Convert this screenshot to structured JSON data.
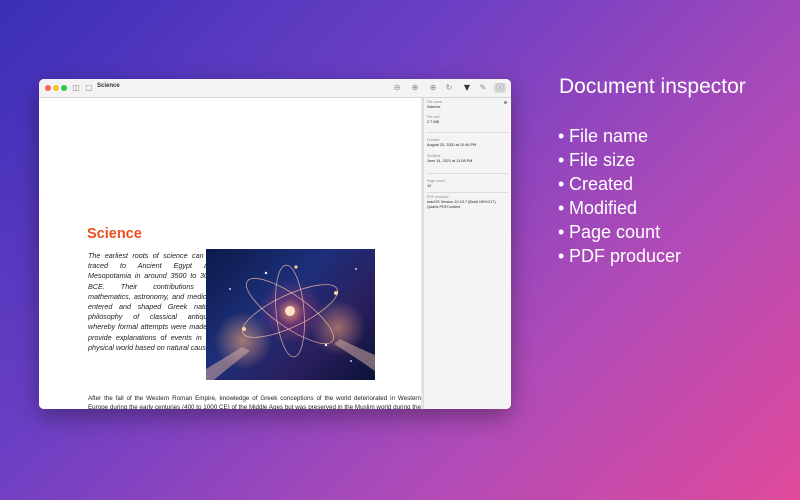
{
  "window": {
    "document_title": "Science",
    "toolbar_icons": [
      "sidebar-toggle-icon",
      "document-icon",
      "zoom-out-icon",
      "zoom-in-icon",
      "zoom-fit-icon",
      "rotate-icon",
      "highlight-icon",
      "markup-icon",
      "info-icon"
    ]
  },
  "document": {
    "title": "Science",
    "intro": "The earliest roots of science can be traced to Ancient Egypt and Mesopotamia in around 3500 to 3000 BCE. Their contributions to mathematics, astronomy, and medicine entered and shaped Greek natural philosophy of classical antiquity, whereby formal attempts were made to provide explanations of events in the physical world based on natural causes.",
    "body": "After the fall of the Western Roman Empire, knowledge of Greek conceptions of the world deteriorated in Western Europe during the early centuries (400 to 1000 CE) of the Middle Ages but was preserved in the Muslim world during the Islamic Golden Age. The recovery and assimilation of Greek works and Islamic inquiries into Western Europe from the 10th to 13th century revived \"natural philosophy\", which was later transformed by the Scientific Revolution that began in the 16th century as new ideas and discoveries departed from previous Greek conceptions and traditions. The scientific method soon played a greater role in knowledge creation and it was not until the 19th century that many of the institutional and professional features of science began to take shape; along with the changing of \"natural philosophy\" to \"natural science.\""
  },
  "inspector": {
    "file_name_label": "File name",
    "file_name": "Science",
    "file_size_label": "File size",
    "file_size": "2.7 MB",
    "created_label": "Created",
    "created": "August 20, 2020 at 10:46 PM",
    "modified_label": "Modified",
    "modified": "June 14, 2021 at 11:08 PM",
    "page_count_label": "Page count",
    "page_count": "19",
    "producer_label": "PDF producer",
    "producer": "macOS Version 10.15.7 (Build 19H1217)\nQuartz PDFContext"
  },
  "promo": {
    "headline": "Document inspector",
    "features": [
      "File name",
      "File size",
      "Created",
      "Modified",
      "Page count",
      "PDF producer"
    ],
    "bullet": "•"
  },
  "colors": {
    "accent_title": "#ee4d1c",
    "background_start": "#3a2fb8",
    "background_end": "#e04a9a"
  }
}
